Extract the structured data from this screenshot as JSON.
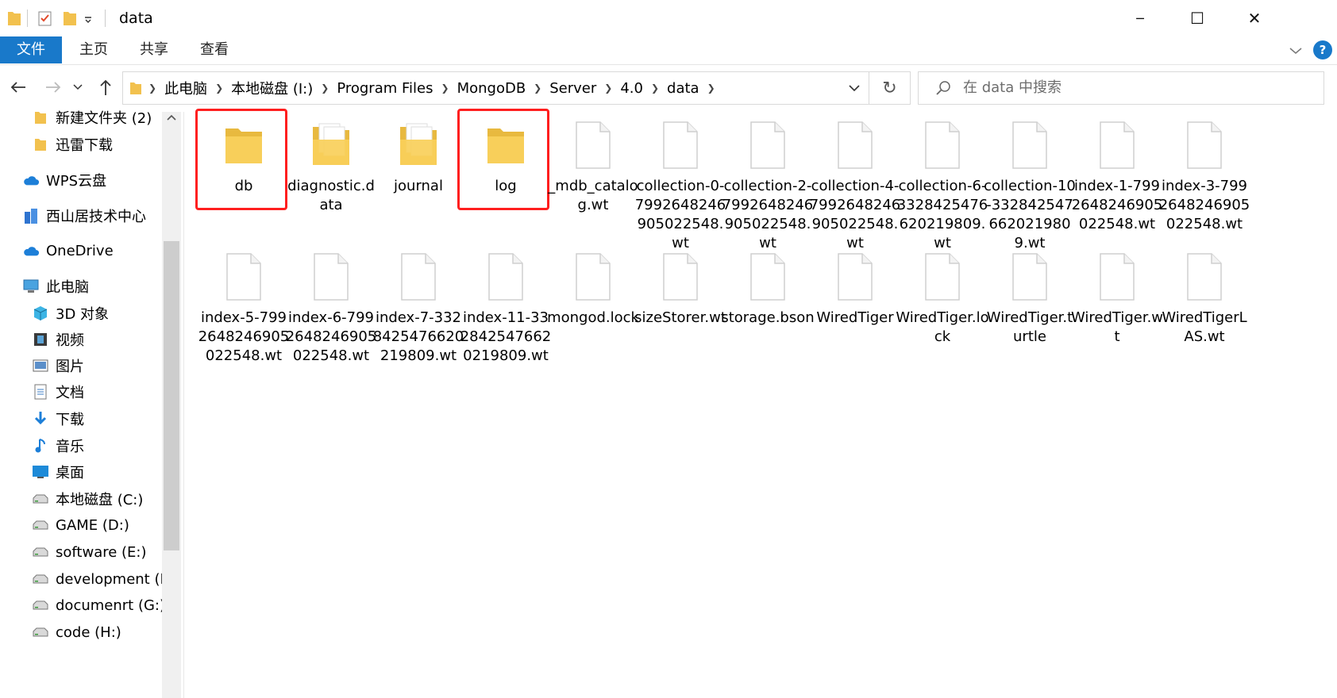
{
  "window": {
    "title": "data",
    "minimize_glyph": "─",
    "maximize_glyph": "☐",
    "close_glyph": "✕"
  },
  "ribbon": {
    "tabs": [
      "文件",
      "主页",
      "共享",
      "查看"
    ]
  },
  "address": {
    "breadcrumbs": [
      "此电脑",
      "本地磁盘 (I:)",
      "Program Files",
      "MongoDB",
      "Server",
      "4.0",
      "data"
    ],
    "search_placeholder": "在 data 中搜索"
  },
  "sidebar": {
    "items": [
      {
        "label": "新建文件夹 (2)",
        "icon": "folder-icon"
      },
      {
        "label": "迅雷下载",
        "icon": "folder-icon"
      },
      {
        "label": "WPS云盘",
        "icon": "cloud-icon"
      },
      {
        "label": "西山居技术中心",
        "icon": "building-icon"
      },
      {
        "label": "OneDrive",
        "icon": "cloud-icon"
      },
      {
        "label": "此电脑",
        "icon": "computer-icon"
      },
      {
        "label": "3D 对象",
        "icon": "cube-icon"
      },
      {
        "label": "视频",
        "icon": "film-icon"
      },
      {
        "label": "图片",
        "icon": "picture-icon"
      },
      {
        "label": "文档",
        "icon": "document-icon"
      },
      {
        "label": "下载",
        "icon": "download-icon"
      },
      {
        "label": "音乐",
        "icon": "music-icon"
      },
      {
        "label": "桌面",
        "icon": "desktop-icon"
      },
      {
        "label": "本地磁盘 (C:)",
        "icon": "drive-icon"
      },
      {
        "label": "GAME (D:)",
        "icon": "drive-icon"
      },
      {
        "label": "software (E:)",
        "icon": "drive-icon"
      },
      {
        "label": "development (F",
        "icon": "drive-icon"
      },
      {
        "label": "documenrt (G:)",
        "icon": "drive-icon"
      },
      {
        "label": "code (H:)",
        "icon": "drive-icon"
      }
    ]
  },
  "files": [
    {
      "name": "db",
      "type": "folder",
      "highlighted": true
    },
    {
      "name": "diagnostic.data",
      "type": "folder-docs",
      "highlighted": false
    },
    {
      "name": "journal",
      "type": "folder-docs",
      "highlighted": false
    },
    {
      "name": "log",
      "type": "folder",
      "highlighted": true
    },
    {
      "name": "_mdb_catalog.wt",
      "type": "file",
      "highlighted": false
    },
    {
      "name": "collection-0-7992648246905022548.wt",
      "type": "file",
      "highlighted": false
    },
    {
      "name": "collection-2-7992648246905022548.wt",
      "type": "file",
      "highlighted": false
    },
    {
      "name": "collection-4-7992648246905022548.wt",
      "type": "file",
      "highlighted": false
    },
    {
      "name": "collection-6-3328425476620219809.wt",
      "type": "file",
      "highlighted": false
    },
    {
      "name": "collection-10-3328425476620219809.wt",
      "type": "file",
      "highlighted": false
    },
    {
      "name": "index-1-7992648246905022548.wt",
      "type": "file",
      "highlighted": false
    },
    {
      "name": "index-3-7992648246905022548.wt",
      "type": "file",
      "highlighted": false
    },
    {
      "name": "index-5-7992648246905022548.wt",
      "type": "file",
      "highlighted": false
    },
    {
      "name": "index-6-7992648246905022548.wt",
      "type": "file",
      "highlighted": false
    },
    {
      "name": "index-7-3328425476620219809.wt",
      "type": "file",
      "highlighted": false
    },
    {
      "name": "index-11-3328425476620219809.wt",
      "type": "file",
      "highlighted": false
    },
    {
      "name": "mongod.lock",
      "type": "file",
      "highlighted": false
    },
    {
      "name": "sizeStorer.wt",
      "type": "file",
      "highlighted": false
    },
    {
      "name": "storage.bson",
      "type": "file",
      "highlighted": false
    },
    {
      "name": "WiredTiger",
      "type": "file",
      "highlighted": false
    },
    {
      "name": "WiredTiger.lock",
      "type": "file",
      "highlighted": false
    },
    {
      "name": "WiredTiger.turtle",
      "type": "file",
      "highlighted": false
    },
    {
      "name": "WiredTiger.wt",
      "type": "file",
      "highlighted": false
    },
    {
      "name": "WiredTigerLAS.wt",
      "type": "file",
      "highlighted": false
    }
  ],
  "colors": {
    "accent": "#1979ca",
    "folder": "#f8cf5a",
    "highlight": "#ff1f1f"
  }
}
